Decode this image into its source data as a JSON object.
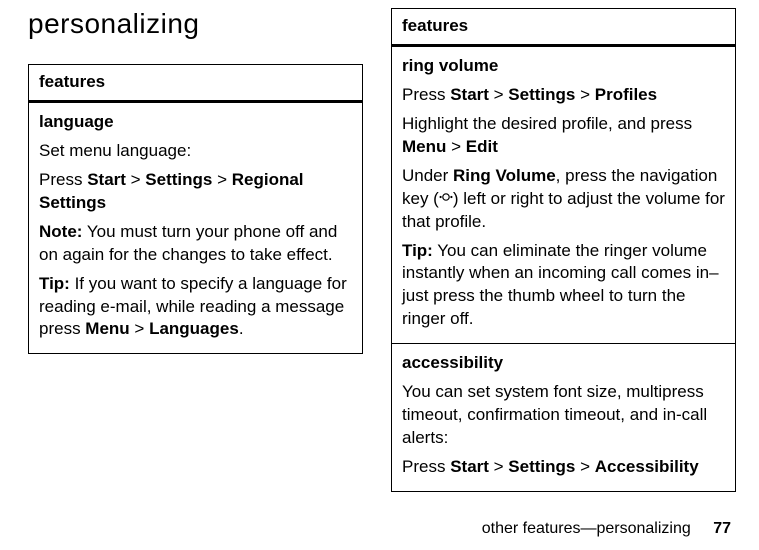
{
  "title": "personalizing",
  "left": {
    "features_header": "features",
    "language": {
      "title": "language",
      "intro": "Set menu language:",
      "press_prefix": "Press ",
      "start": "Start",
      "gt1": " > ",
      "settings": "Settings",
      "gt2": " > ",
      "regional": "Regional Settings",
      "note_label": "Note:",
      "note_text": " You must turn your phone off and on again for the changes to take effect.",
      "tip_label": "Tip:",
      "tip_text_a": " If you want to specify a language for reading e-mail, while reading a message press ",
      "menu": "Menu",
      "gt3": " > ",
      "languages": "Languages",
      "tip_text_b": "."
    }
  },
  "right": {
    "features_header": "features",
    "ring": {
      "title": "ring volume",
      "press_prefix": "Press ",
      "start": "Start",
      "gt1": " > ",
      "settings": "Settings",
      "gt2": " > ",
      "profiles": "Profiles",
      "highlight_a": "Highlight the desired profile, and press ",
      "menu": "Menu",
      "gt3": " > ",
      "edit": "Edit",
      "under_a": "Under ",
      "ringvol": "Ring Volume",
      "under_b": ", press the navigation key (",
      "under_c": ") left or right to adjust the volume for that profile.",
      "tip_label": "Tip:",
      "tip_text": " You can eliminate the ringer volume instantly when an incoming call comes in–just press the thumb wheel to turn the ringer off."
    },
    "access": {
      "title": "accessibility",
      "intro": "You can set system font size, multipress timeout, confirmation timeout, and in-call alerts:",
      "press_prefix": "Press ",
      "start": "Start",
      "gt1": " > ",
      "settings": "Settings",
      "gt2": " > ",
      "accessibility": "Accessibility"
    }
  },
  "footer": {
    "text": "other features—personalizing",
    "page": "77"
  }
}
